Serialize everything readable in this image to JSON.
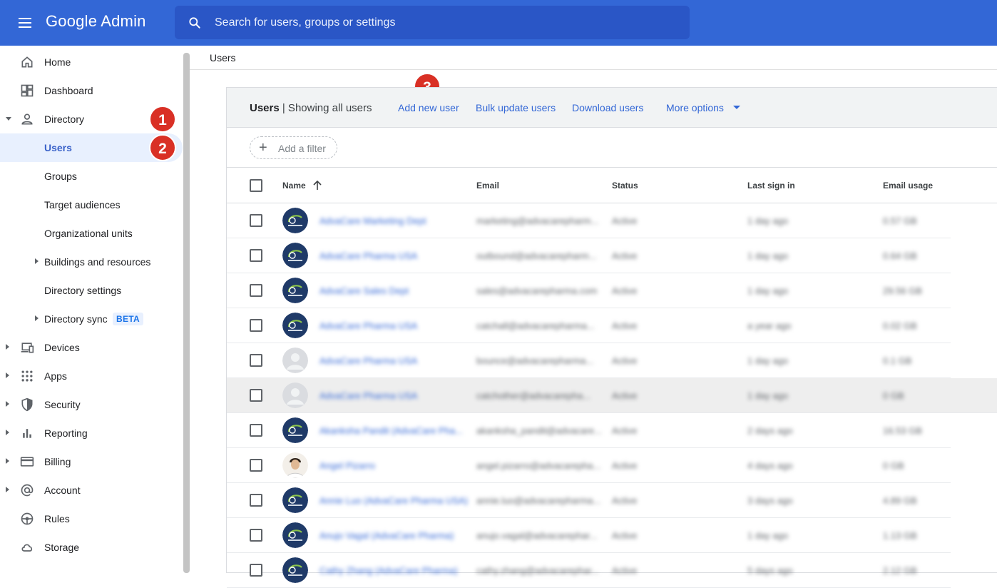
{
  "header": {
    "brand": "Google Admin",
    "search_placeholder": "Search for users, groups or settings"
  },
  "sidebar": {
    "items": [
      {
        "label": "Home",
        "icon": "home-icon"
      },
      {
        "label": "Dashboard",
        "icon": "dashboard-icon"
      },
      {
        "label": "Directory",
        "icon": "person-icon"
      },
      {
        "label": "Users"
      },
      {
        "label": "Groups"
      },
      {
        "label": "Target audiences"
      },
      {
        "label": "Organizational units"
      },
      {
        "label": "Buildings and resources"
      },
      {
        "label": "Directory settings"
      },
      {
        "label": "Directory sync",
        "badge": "BETA"
      },
      {
        "label": "Devices",
        "icon": "devices-icon"
      },
      {
        "label": "Apps",
        "icon": "apps-grid-icon"
      },
      {
        "label": "Security",
        "icon": "shield-icon"
      },
      {
        "label": "Reporting",
        "icon": "bar-chart-icon"
      },
      {
        "label": "Billing",
        "icon": "credit-card-icon"
      },
      {
        "label": "Account",
        "icon": "at-sign-icon"
      },
      {
        "label": "Rules",
        "icon": "rules-icon"
      },
      {
        "label": "Storage",
        "icon": "cloud-icon"
      }
    ]
  },
  "annotations": {
    "step1": "1",
    "step2": "2",
    "step3": "3"
  },
  "breadcrumb": "Users",
  "card": {
    "title_bold": "Users",
    "title_rest": " | Showing all users",
    "actions": [
      "Add new user",
      "Bulk update users",
      "Download users",
      "More options"
    ],
    "filter_label": "Add a filter"
  },
  "table": {
    "columns": [
      "Name",
      "Email",
      "Status",
      "Last sign in",
      "Email usage"
    ],
    "rows": [
      {
        "name": "AdvaCare Marketing Dept",
        "email": "marketing@advacarepharm...",
        "status": "Active",
        "signin": "1 day ago",
        "usage": "0.57 GB",
        "avatar": "logo"
      },
      {
        "name": "AdvaCare Pharma USA",
        "email": "outbound@advacarepharm...",
        "status": "Active",
        "signin": "1 day ago",
        "usage": "0.64 GB",
        "avatar": "logo"
      },
      {
        "name": "AdvaCare Sales Dept",
        "email": "sales@advacarepharma.com",
        "status": "Active",
        "signin": "1 day ago",
        "usage": "29.56 GB",
        "avatar": "logo"
      },
      {
        "name": "AdvaCare Pharma USA",
        "email": "catchall@advacarepharma...",
        "status": "Active",
        "signin": "a year ago",
        "usage": "0.02 GB",
        "avatar": "logo"
      },
      {
        "name": "AdvaCare Pharma USA",
        "email": "bounce@advacarepharma...",
        "status": "Active",
        "signin": "1 day ago",
        "usage": "0.1 GB",
        "avatar": "default"
      },
      {
        "name": "AdvaCare Pharma USA",
        "email": "catchother@advacarepha...",
        "status": "Active",
        "signin": "1 day ago",
        "usage": "0 GB",
        "avatar": "default"
      },
      {
        "name": "Akanksha Pandit (AdvaCare Pha...",
        "email": "akanksha_pandit@advacare...",
        "status": "Active",
        "signin": "2 days ago",
        "usage": "16.53 GB",
        "avatar": "logo"
      },
      {
        "name": "Angel Pizarro",
        "email": "angel.pizarro@advacarepha...",
        "status": "Active",
        "signin": "4 days ago",
        "usage": "0 GB",
        "avatar": "photo"
      },
      {
        "name": "Annie Luo (AdvaCare Pharma USA)",
        "email": "annie.luo@advacarepharma...",
        "status": "Active",
        "signin": "3 days ago",
        "usage": "4.89 GB",
        "avatar": "logo"
      },
      {
        "name": "Anujo Vagal (AdvaCare Pharma)",
        "email": "anujo.vagal@advacarephar...",
        "status": "Active",
        "signin": "1 day ago",
        "usage": "1.13 GB",
        "avatar": "logo"
      },
      {
        "name": "Cathy Zhang (AdvaCare Pharma)",
        "email": "cathy.zhang@advacarephar...",
        "status": "Active",
        "signin": "5 days ago",
        "usage": "2.12 GB",
        "avatar": "logo"
      }
    ]
  },
  "colors": {
    "topbar": "#3367d6",
    "search": "#2a56c6",
    "link": "#3367d6",
    "badge": "#d93025"
  }
}
